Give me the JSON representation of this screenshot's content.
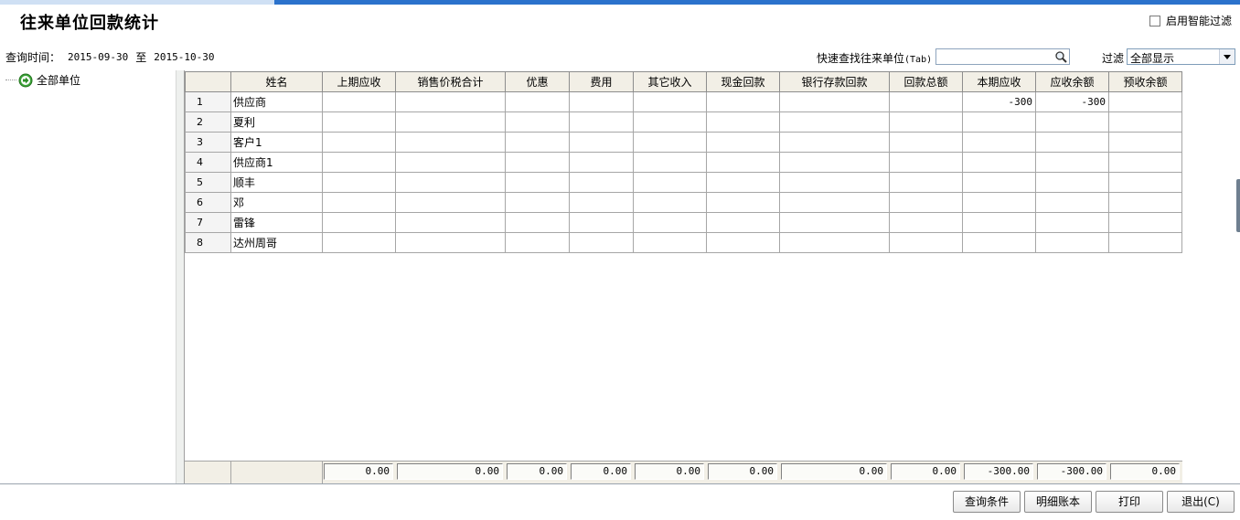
{
  "title": "往来单位回款统计",
  "smart_filter": {
    "label": "启用智能过滤",
    "checked": false
  },
  "query": {
    "label": "查询时间：",
    "start": "2015-09-30",
    "sep": "至",
    "end": "2015-10-30"
  },
  "quick_search": {
    "label": "快速查找往来单位",
    "hint": "(Tab)",
    "value": "",
    "icon": "search-icon"
  },
  "filter": {
    "label": "过滤",
    "selected": "全部显示"
  },
  "tree": {
    "root_label": "全部单位",
    "icon": "forward-arrow-icon"
  },
  "table": {
    "columns": [
      "姓名",
      "上期应收",
      "销售价税合计",
      "优惠",
      "费用",
      "其它收入",
      "现金回款",
      "银行存款回款",
      "回款总额",
      "本期应收",
      "应收余额",
      "预收余额"
    ],
    "rows": [
      {
        "no": "1",
        "name": "供应商",
        "prev": "",
        "sales": "",
        "discount": "",
        "fee": "",
        "other": "",
        "cash": "",
        "bank": "",
        "total": "",
        "current": "-300",
        "balance": "-300",
        "prepaid": ""
      },
      {
        "no": "2",
        "name": "夏利",
        "prev": "",
        "sales": "",
        "discount": "",
        "fee": "",
        "other": "",
        "cash": "",
        "bank": "",
        "total": "",
        "current": "",
        "balance": "",
        "prepaid": ""
      },
      {
        "no": "3",
        "name": "客户1",
        "prev": "",
        "sales": "",
        "discount": "",
        "fee": "",
        "other": "",
        "cash": "",
        "bank": "",
        "total": "",
        "current": "",
        "balance": "",
        "prepaid": ""
      },
      {
        "no": "4",
        "name": "供应商1",
        "prev": "",
        "sales": "",
        "discount": "",
        "fee": "",
        "other": "",
        "cash": "",
        "bank": "",
        "total": "",
        "current": "",
        "balance": "",
        "prepaid": ""
      },
      {
        "no": "5",
        "name": "顺丰",
        "prev": "",
        "sales": "",
        "discount": "",
        "fee": "",
        "other": "",
        "cash": "",
        "bank": "",
        "total": "",
        "current": "",
        "balance": "",
        "prepaid": ""
      },
      {
        "no": "6",
        "name": "邓",
        "prev": "",
        "sales": "",
        "discount": "",
        "fee": "",
        "other": "",
        "cash": "",
        "bank": "",
        "total": "",
        "current": "",
        "balance": "",
        "prepaid": ""
      },
      {
        "no": "7",
        "name": "雷锋",
        "prev": "",
        "sales": "",
        "discount": "",
        "fee": "",
        "other": "",
        "cash": "",
        "bank": "",
        "total": "",
        "current": "",
        "balance": "",
        "prepaid": ""
      },
      {
        "no": "8",
        "name": "达州周哥",
        "prev": "",
        "sales": "",
        "discount": "",
        "fee": "",
        "other": "",
        "cash": "",
        "bank": "",
        "total": "",
        "current": "",
        "balance": "",
        "prepaid": ""
      }
    ],
    "totals": [
      "0.00",
      "0.00",
      "0.00",
      "0.00",
      "0.00",
      "0.00",
      "0.00",
      "0.00",
      "-300.00",
      "-300.00",
      "0.00"
    ]
  },
  "buttons": {
    "query_conditions": "查询条件",
    "detail_ledger": "明细账本",
    "print": "打印",
    "exit": "退出(C)"
  }
}
